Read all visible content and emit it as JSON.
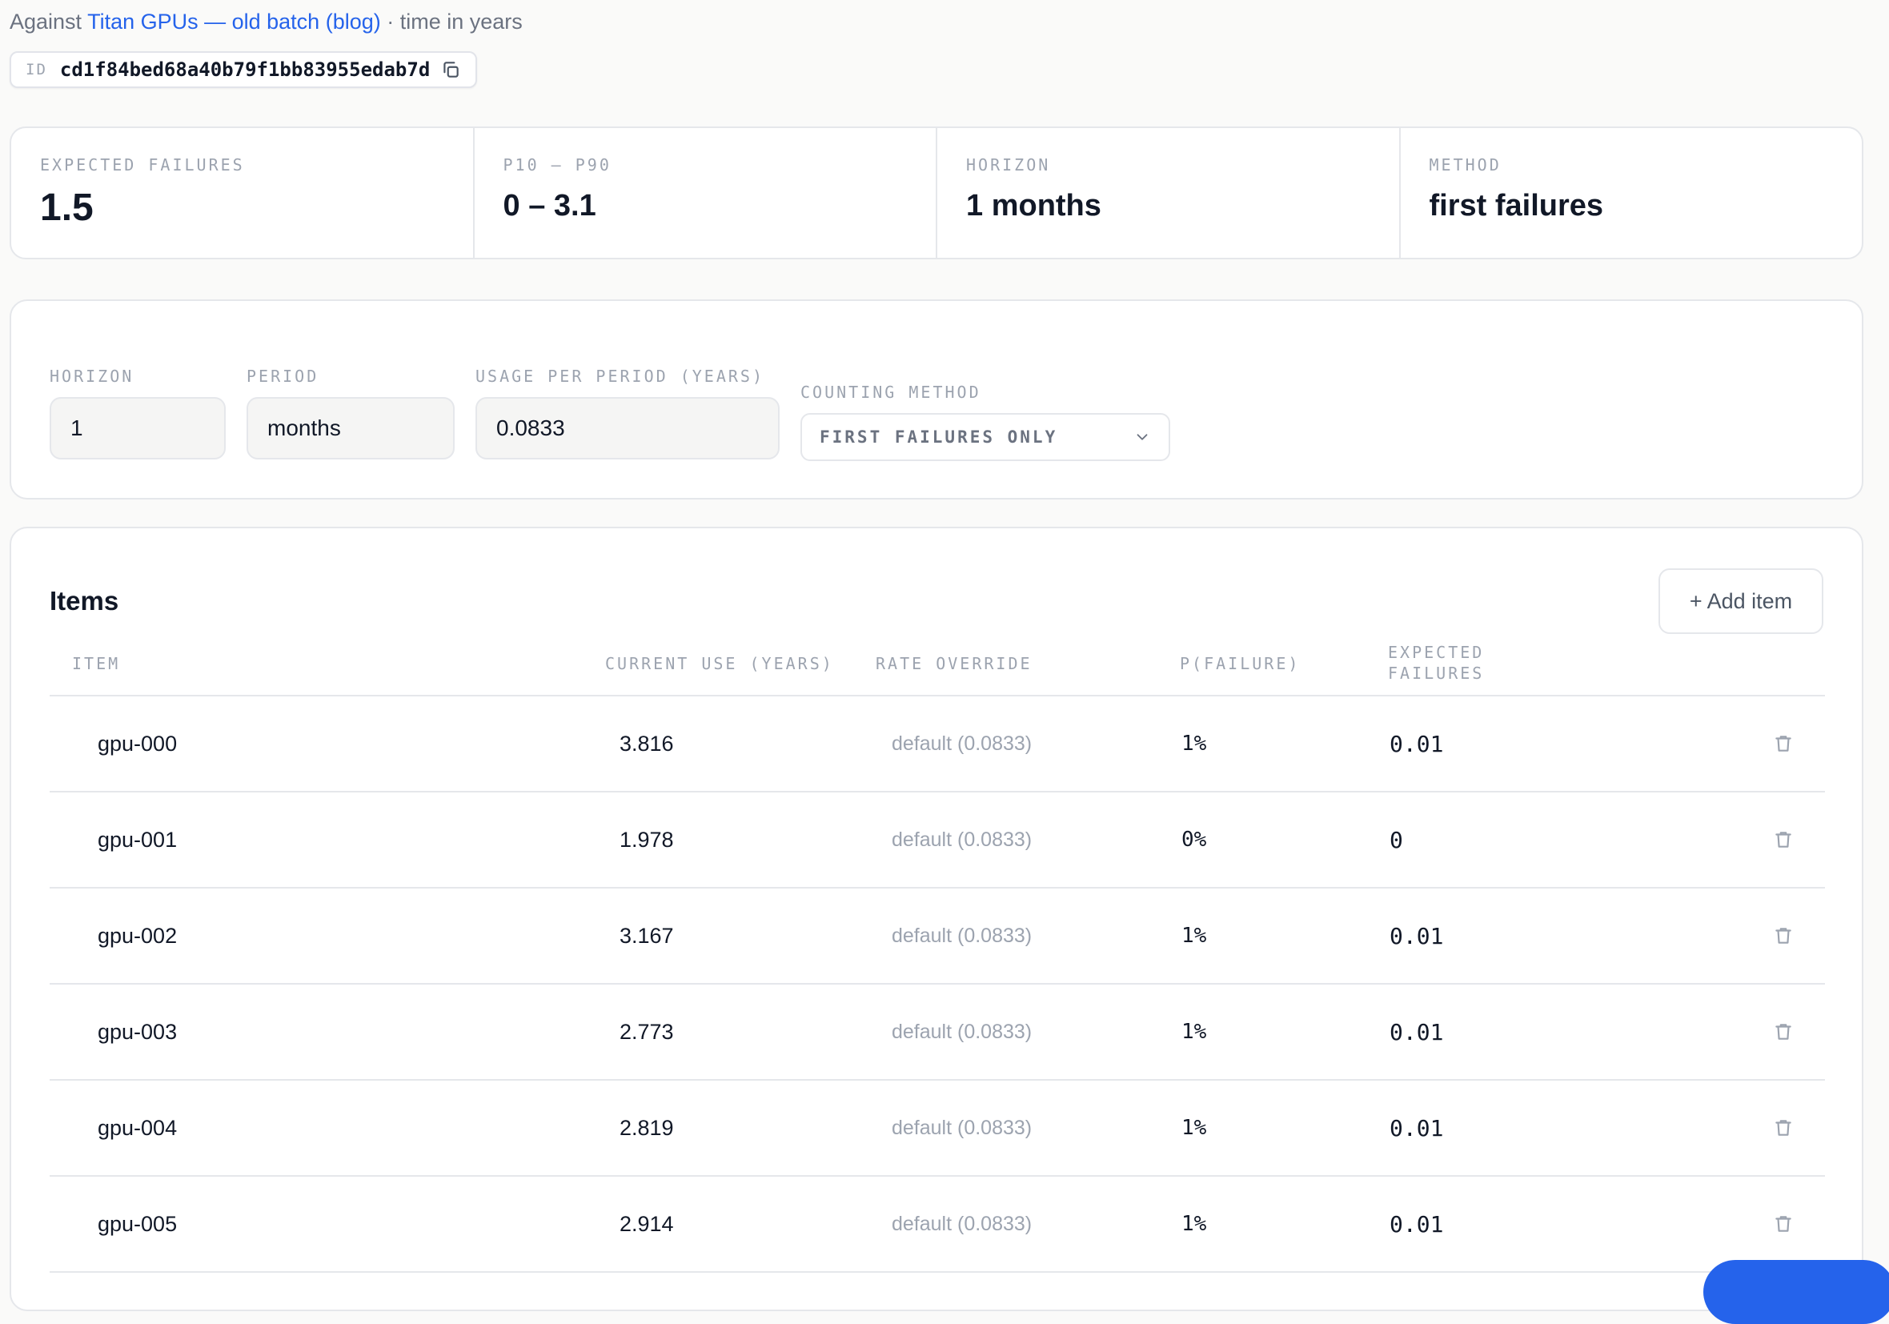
{
  "header": {
    "prefix": "Against",
    "link": "Titan GPUs — old batch (blog)",
    "suffix": "· time in years"
  },
  "id_chip": {
    "label": "ID",
    "value": "cd1f84bed68a40b79f1bb83955edab7d"
  },
  "stats": {
    "expected_failures": {
      "label": "EXPECTED FAILURES",
      "value": "1.5"
    },
    "p10_p90": {
      "label": "P10 – P90",
      "value": "0 – 3.1"
    },
    "horizon": {
      "label": "HORIZON",
      "value": "1 months"
    },
    "method": {
      "label": "METHOD",
      "value": "first failures"
    }
  },
  "controls": {
    "horizon": {
      "label": "HORIZON",
      "value": "1"
    },
    "period": {
      "label": "PERIOD",
      "value": "months"
    },
    "usage": {
      "label": "USAGE PER PERIOD (YEARS)",
      "value": "0.0833"
    },
    "counting": {
      "label": "COUNTING METHOD",
      "value": "FIRST FAILURES ONLY"
    }
  },
  "items": {
    "title": "Items",
    "add_label": "+ Add item",
    "columns": {
      "item": "ITEM",
      "current_use": "CURRENT USE (YEARS)",
      "rate_override": "RATE OVERRIDE",
      "p_failure": "P(FAILURE)",
      "expected_line1": "EXPECTED",
      "expected_line2": "FAILURES"
    },
    "rows": [
      {
        "name": "gpu-000",
        "current_use": "3.816",
        "rate": "default (0.0833)",
        "p_failure": "1%",
        "expected": "0.01"
      },
      {
        "name": "gpu-001",
        "current_use": "1.978",
        "rate": "default (0.0833)",
        "p_failure": "0%",
        "expected": "0"
      },
      {
        "name": "gpu-002",
        "current_use": "3.167",
        "rate": "default (0.0833)",
        "p_failure": "1%",
        "expected": "0.01"
      },
      {
        "name": "gpu-003",
        "current_use": "2.773",
        "rate": "default (0.0833)",
        "p_failure": "1%",
        "expected": "0.01"
      },
      {
        "name": "gpu-004",
        "current_use": "2.819",
        "rate": "default (0.0833)",
        "p_failure": "1%",
        "expected": "0.01"
      },
      {
        "name": "gpu-005",
        "current_use": "2.914",
        "rate": "default (0.0833)",
        "p_failure": "1%",
        "expected": "0.01"
      }
    ]
  },
  "icons": {
    "copy": "copy-icon",
    "chevron": "chevron-down-icon",
    "delete": "trash-icon"
  },
  "colors": {
    "link": "#2563eb",
    "accent": "#2563eb",
    "muted": "#9ca3af"
  }
}
